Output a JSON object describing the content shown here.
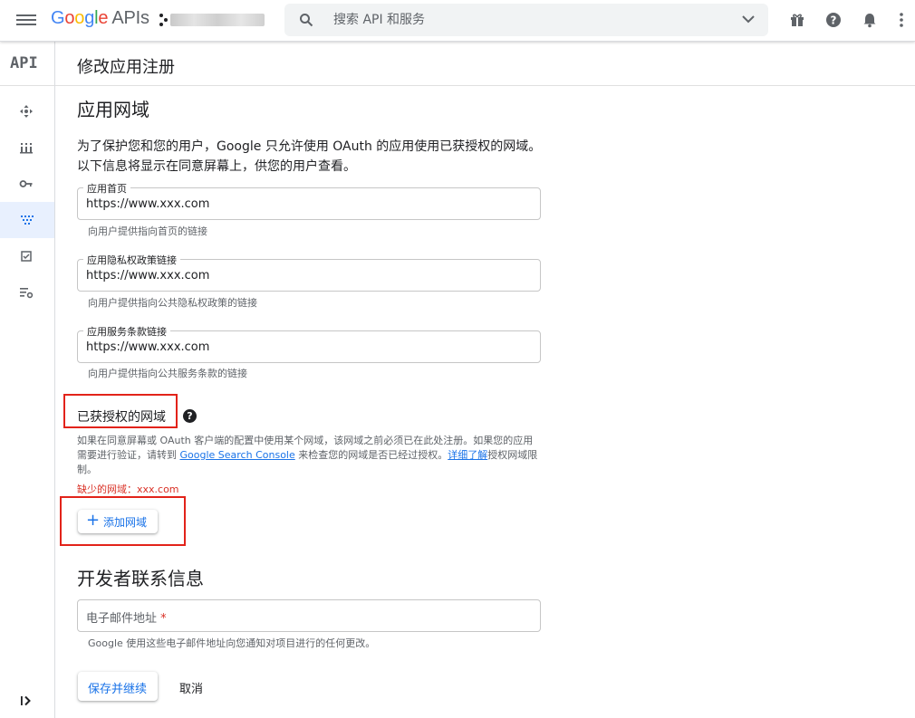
{
  "topbar": {
    "logo_google": "Google",
    "logo_apis": "APIs",
    "search_placeholder": "搜索 API 和服务"
  },
  "rail": {
    "api_label": "API",
    "items": [
      "move-icon",
      "grid-icon",
      "key-icon",
      "dots-icon",
      "checkbox-icon",
      "settings-list-icon"
    ]
  },
  "page": {
    "title": "修改应用注册"
  },
  "app_domain": {
    "heading": "应用网域",
    "description": "为了保护您和您的用户，Google 只允许使用 OAuth 的应用使用已获授权的网域。以下信息将显示在同意屏幕上，供您的用户查看。",
    "homepage": {
      "label": "应用首页",
      "value": "https://www.xxx.com",
      "hint": "向用户提供指向首页的链接"
    },
    "privacy": {
      "label": "应用隐私权政策链接",
      "value": "https://www.xxx.com",
      "hint": "向用户提供指向公共隐私权政策的链接"
    },
    "terms": {
      "label": "应用服务条款链接",
      "value": "https://www.xxx.com",
      "hint": "向用户提供指向公共服务条款的链接"
    }
  },
  "authorized": {
    "title": "已获授权的网域",
    "help": "?",
    "desc_part1": "如果在同意屏幕或 OAuth 客户端的配置中使用某个网域，该网域之前必须已在此处注册。如果您的应用需要进行验证，请转到 ",
    "desc_link1": "Google Search Console",
    "desc_part2": " 来检查您的网域是否已经过授权。",
    "desc_link2": "详细了解",
    "desc_part3": "授权网域限制。",
    "missing": "缺少的网域：xxx.com",
    "add_button": "添加网域",
    "add_plus": "+"
  },
  "developer": {
    "heading": "开发者联系信息",
    "email_placeholder": "电子邮件地址",
    "email_required": "*",
    "email_hint": "Google 使用这些电子邮件地址向您通知对项目进行的任何更改。"
  },
  "actions": {
    "save": "保存并继续",
    "cancel": "取消"
  },
  "colors": {
    "accent": "#1a73e8",
    "highlight_box": "#e2231a",
    "error": "#d93025"
  }
}
